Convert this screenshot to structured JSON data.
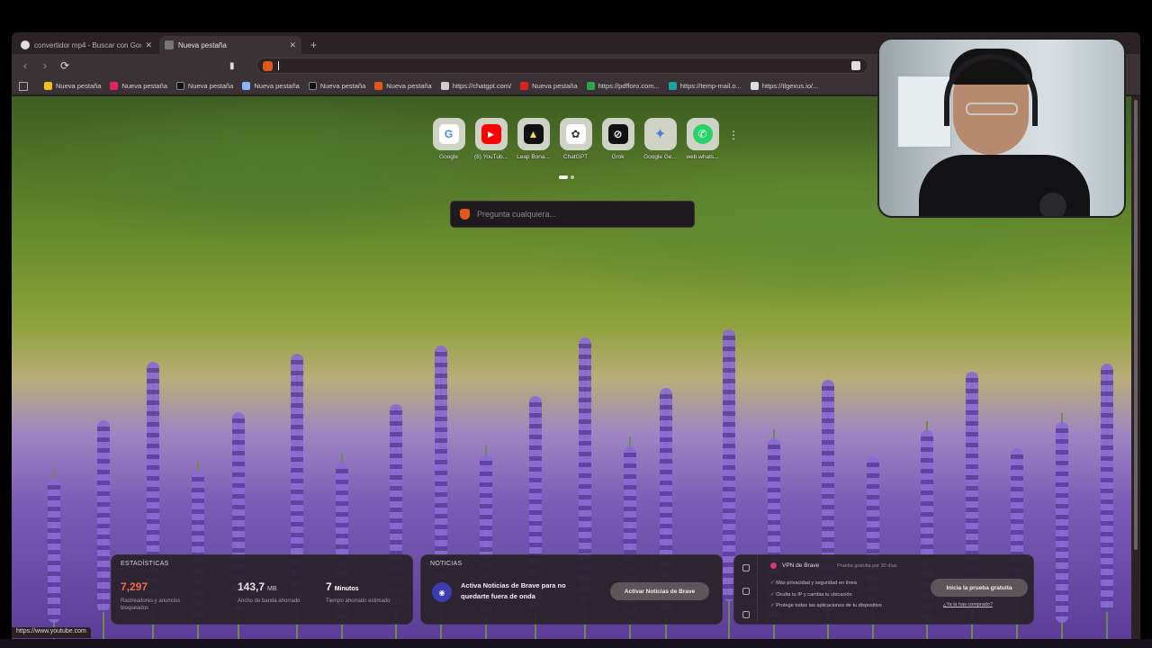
{
  "tabs": [
    {
      "title": "convertidor mp4 - Buscar con Googl",
      "active": false,
      "favicon_color": "#dddddd"
    },
    {
      "title": "Nueva pestaña",
      "active": true,
      "favicon_color": "#777777"
    }
  ],
  "bookmarks": [
    {
      "label": "Nueva pestaña",
      "color": "#f0c020"
    },
    {
      "label": "Nueva pestaña",
      "color": "#e0245e"
    },
    {
      "label": "Nueva pestaña",
      "color": "#111111"
    },
    {
      "label": "Nueva pestaña",
      "color": "#8ab4f8"
    },
    {
      "label": "Nueva pestaña",
      "color": "#111111"
    },
    {
      "label": "Nueva pestaña",
      "color": "#e2581a"
    },
    {
      "label": "https://chatgpt.com/",
      "color": "#cccccc"
    },
    {
      "label": "Nueva pestaña",
      "color": "#e02020"
    },
    {
      "label": "https://pdfforo.com...",
      "color": "#2da44e"
    },
    {
      "label": "https://temp-mail.o...",
      "color": "#20a0a0"
    },
    {
      "label": "https://tlgexus.io/...",
      "color": "#dddddd"
    }
  ],
  "shortcuts": [
    {
      "label": "Google",
      "icon": "google-icon",
      "glyph": "G",
      "color": "#4285f4"
    },
    {
      "label": "(8) YouTub...",
      "icon": "youtube-icon",
      "glyph": "▶",
      "color": "#ff0000"
    },
    {
      "label": "Leap Bona...",
      "icon": "leap-icon",
      "glyph": "▲",
      "color": "#111111"
    },
    {
      "label": "ChatGPT",
      "icon": "chatgpt-icon",
      "glyph": "✿",
      "color": "#6f6f6f"
    },
    {
      "label": "Grok",
      "icon": "grok-icon",
      "glyph": "⊘",
      "color": "#111111"
    },
    {
      "label": "Google Ge...",
      "icon": "gemini-icon",
      "glyph": "✦",
      "color": "#4a7fe0"
    },
    {
      "label": "web.whats...",
      "icon": "whatsapp-icon",
      "glyph": "✆",
      "color": "#25d366"
    }
  ],
  "search": {
    "placeholder": "Pregunta cualquiera..."
  },
  "stats": {
    "title": "ESTADÍSTICAS",
    "items": [
      {
        "value": "7,297",
        "unit": "",
        "desc": "Rastreadores y anuncios bloqueados",
        "color": "#f06a4a"
      },
      {
        "value": "143,7",
        "unit": "MB",
        "desc": "Ancho de banda ahorrado",
        "color": "#e8e2e5"
      },
      {
        "value": "7",
        "unit": "Minutos",
        "desc": "Tiempo ahorrado estimado",
        "color": "#ffffff"
      }
    ]
  },
  "news": {
    "title": "NOTICIAS",
    "text": "Activa Noticias de Brave para no quedarte fuera de onda",
    "button": "Activar Noticias de Brave"
  },
  "vpn": {
    "title": "VPN de Brave",
    "subtitle": "Prueba gratuita por 30 días",
    "features": [
      "Más privacidad y seguridad en línea",
      "Oculta tu IP y cambia tu ubicación",
      "Protege todas las aplicaciones de tu dispositivo"
    ],
    "button": "Inicia la prueba gratuita",
    "link": "¿Ya la has comprado?"
  },
  "status_url": "https://www.youtube.com",
  "colors": {
    "brave_orange": "#e2581a",
    "lavender": "#7a5bb6"
  }
}
